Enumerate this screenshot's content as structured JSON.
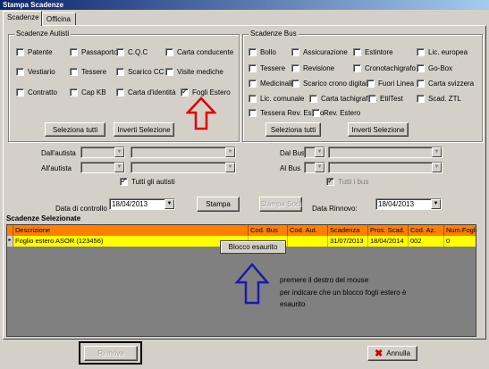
{
  "window": {
    "title": "Stampa Scadenze"
  },
  "tabs": [
    {
      "label": "Scadenze"
    },
    {
      "label": "Officina"
    }
  ],
  "autisti": {
    "title": "Scadenze Autisti",
    "items": [
      {
        "label": "Patente",
        "checked": false
      },
      {
        "label": "Passaporto",
        "checked": false
      },
      {
        "label": "C.Q.C",
        "checked": false
      },
      {
        "label": "Carta conducente",
        "checked": false
      },
      {
        "label": "Vestiario",
        "checked": false
      },
      {
        "label": "Tessere",
        "checked": false
      },
      {
        "label": "Scarico CC",
        "checked": false
      },
      {
        "label": "Visite mediche",
        "checked": false
      },
      {
        "label": "Contratto",
        "checked": false
      },
      {
        "label": "Cap KB",
        "checked": false
      },
      {
        "label": "Carta d'identità",
        "checked": false
      },
      {
        "label": "Fogli Estero",
        "checked": true
      }
    ],
    "select_all": "Seleziona tutti",
    "invert": "Inverti Selezione"
  },
  "bus": {
    "title": "Scadenze Bus",
    "items": [
      {
        "label": "Bollo",
        "checked": false
      },
      {
        "label": "Assicurazione",
        "checked": false
      },
      {
        "label": "Estintore",
        "checked": false
      },
      {
        "label": "Lic. europea",
        "checked": false
      },
      {
        "label": "Tessere",
        "checked": false
      },
      {
        "label": "Revisione",
        "checked": false
      },
      {
        "label": "Cronotachigrafo",
        "checked": false
      },
      {
        "label": "Go-Box",
        "checked": false
      },
      {
        "label": "Medicinali",
        "checked": false
      },
      {
        "label": "Scarico crono digitale",
        "checked": false
      },
      {
        "label": "Fuori Linea",
        "checked": false
      },
      {
        "label": "Carta svizzera",
        "checked": false
      },
      {
        "label": "Lic. comunale",
        "checked": false
      },
      {
        "label": "Carta tachigrafica",
        "checked": false
      },
      {
        "label": "EtilTest",
        "checked": false
      },
      {
        "label": "Scad. ZTL",
        "checked": false
      },
      {
        "label": "Tessera Rev. Estero",
        "checked": false
      },
      {
        "label": "Rev. Estero",
        "checked": false
      }
    ],
    "select_all": "Seleziona tutti",
    "invert": "Inverti Selezione"
  },
  "filters": {
    "from_driver": "Dall'autista",
    "to_driver": "All'autista",
    "all_drivers": "Tutti gli autisti",
    "all_drivers_checked": true,
    "from_bus": "Dal Bus",
    "to_bus": "Al Bus",
    "all_buses": "Tutti i bus",
    "all_buses_checked": true
  },
  "controls": {
    "check_date_label": "Data di controllo",
    "check_date": "18/04/2013",
    "print": "Stampa",
    "print_partners": "Stampa Soci",
    "renew_date_label": "Data Rinnovo:",
    "renew_date": "18/04/2013"
  },
  "selected": {
    "title": "Scadenze Selezionate",
    "columns": [
      "Descrizione",
      "Cod. Bus",
      "Cod. Aut.",
      "Scadenza",
      "Pros. Scad.",
      "Cod. Az.",
      "Num.Fogli"
    ],
    "rows": [
      [
        "Foglio estero ASOR (123456)",
        "",
        "",
        "31/07/2013",
        "18/04/2014",
        "002",
        "0"
      ]
    ],
    "row_marker": "▸"
  },
  "context_menu": {
    "item": "Blocco esaurito"
  },
  "annotation": {
    "line1": "premere il destro del mouse",
    "line2": "per indicare che un blocco fogli estero è",
    "line3": "esaurito",
    "red_arrow_color": "#e00000",
    "blue_arrow_color": "#1a1ab0",
    "highlight_color": "#000000"
  },
  "footer": {
    "renew": "Rinnova",
    "cancel": "Annulla",
    "cancel_icon": "red-x-icon"
  }
}
